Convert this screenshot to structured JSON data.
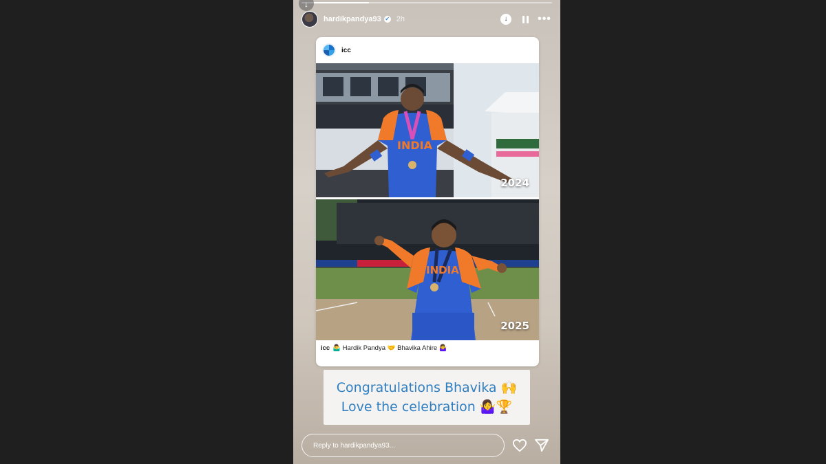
{
  "story": {
    "progress_fraction": 0.27,
    "username": "hardikpandya93",
    "time": "2h",
    "verified": true
  },
  "post": {
    "owner": "icc",
    "year_top": "2024",
    "year_bottom": "2025",
    "caption_user": "icc",
    "caption_text": "🤷‍♂️ Hardik Pandya 🤝 Bhavika Ahire 🤷‍♀️"
  },
  "congrats": {
    "line1": "Congratulations Bhavika 🙌",
    "line2": "Love the celebration 🤷‍♀️🏆"
  },
  "reply": {
    "placeholder": "Reply to hardikpandya93..."
  },
  "colors": {
    "background": "#1f1f1f",
    "congrats_text": "#2f7fc2",
    "jersey_blue": "#2f5fd0",
    "jersey_orange": "#f07a2a"
  },
  "icons": [
    "down-arrow-icon",
    "verified-icon",
    "download-icon",
    "pause-icon",
    "more-icon",
    "heart-icon",
    "send-icon"
  ]
}
